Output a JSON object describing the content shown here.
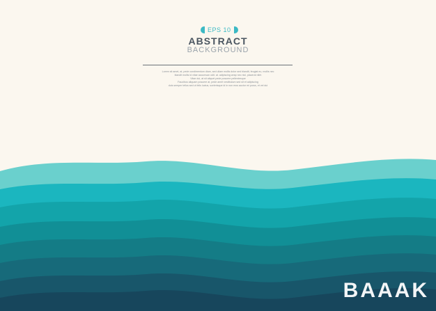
{
  "badge": {
    "text": "EPS 10"
  },
  "title": {
    "main": "ABSTRACT",
    "sub": "BACKGROUND"
  },
  "body_lines": [
    "Lorem sit amet, at, pede condimentum diam, sed ullam mollis dolor sed blandit, feugiat eu, mollis nec",
    "blandit mollis id vitae accumsan odit. at. adipiscing wrap nec nisl, placerat nibh",
    "Vitae dui, at sit aliquet pede posuere pellentesque",
    "Faucibus aliquam posuere at, pede amet vestibulum sed sit et adipiscing",
    "duis semper tellus sed ut felis luctus, scelerisque id in non eros auctor mi purus, et vel dui"
  ],
  "watermark": "BAAAK",
  "colors": {
    "background": "#fbf7ef",
    "accent": "#3bb9c4",
    "waves": [
      "#6ad0cd",
      "#1bb6bf",
      "#13a4aa",
      "#118f96",
      "#147c86",
      "#176a7a",
      "#18566a",
      "#17465c"
    ]
  }
}
